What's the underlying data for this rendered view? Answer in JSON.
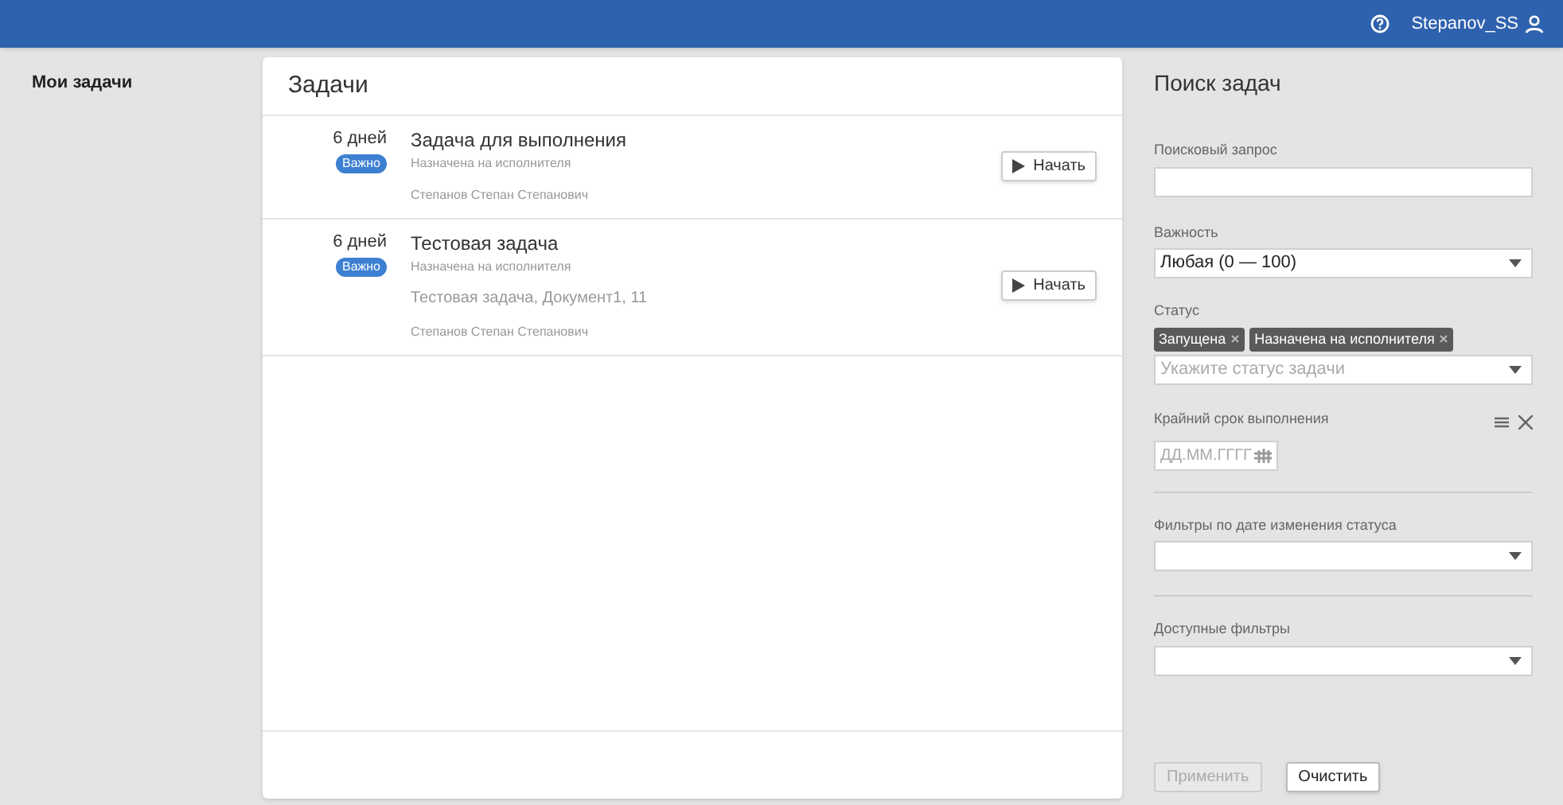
{
  "header": {
    "user": "Stepanov_SS"
  },
  "sidebar": {
    "items": [
      {
        "label": "Мои задачи",
        "selected": true
      }
    ]
  },
  "tasks_panel": {
    "title": "Задачи",
    "tasks": [
      {
        "due": "6 дней",
        "badge": "Важно",
        "color": "#3d7fd1",
        "title": "Задача для выполнения",
        "status": "Назначена на исполнителя",
        "author": "Степанов Степан Степанович",
        "action": "Начать"
      },
      {
        "due": "6 дней",
        "badge": "Важно",
        "color": "#3d7fd1",
        "title": "Тестовая задача",
        "status": "Назначена на исполнителя",
        "details": [
          "Тестовая задача, Документ1, 11"
        ],
        "author": "Степанов Степан Степанович",
        "action": "Начать"
      }
    ]
  },
  "search": {
    "title": "Поиск задач",
    "query": {
      "label": "Поисковый запрос"
    },
    "importance": {
      "label": "Важность",
      "value": "Любая (0 — 100)"
    },
    "status": {
      "label": "Статус",
      "tags": [
        "Запущена",
        "Назначена на исполнителя"
      ],
      "placeholder": "Укажите статус задачи"
    },
    "deadline": {
      "label": "Крайний срок выполнения",
      "placeholder": "ДД.ММ.ГГГГ"
    },
    "status_date_filter": {
      "label": "Фильтры по дате изменения статуса"
    },
    "available_filters": {
      "label": "Доступные фильтры"
    },
    "buttons": [
      {
        "label": "Применить",
        "disabled": true
      },
      {
        "label": "Очистить",
        "disabled": false
      }
    ]
  }
}
